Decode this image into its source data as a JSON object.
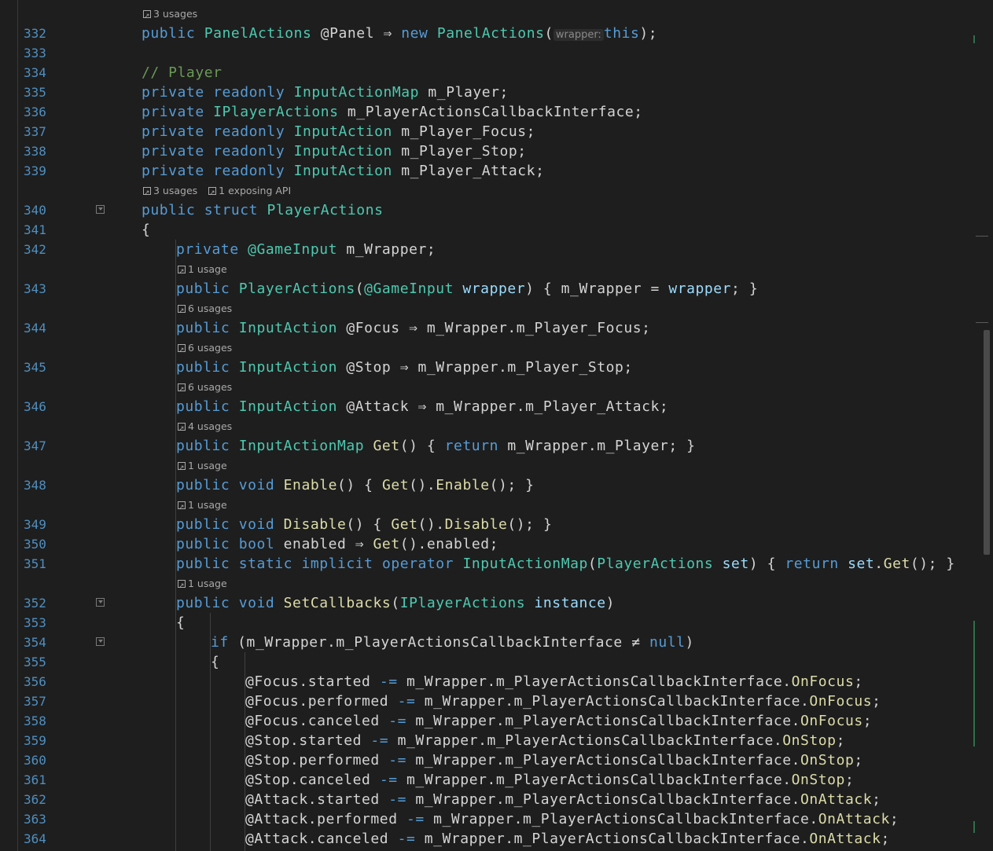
{
  "editor": {
    "language": "C#",
    "first_line_number": 332,
    "rows": [
      {
        "kind": "hint",
        "indent": 2,
        "parts": [
          {
            "icon": "usages-icon",
            "text": "3 usages"
          }
        ]
      },
      {
        "kind": "code",
        "ln": "332",
        "indent": 2,
        "tokens": [
          [
            "kw",
            "public"
          ],
          [
            "t",
            " "
          ],
          [
            "type",
            "PanelActions"
          ],
          [
            "t",
            " @Panel "
          ],
          [
            "op",
            "⇒"
          ],
          [
            "t",
            " "
          ],
          [
            "kw",
            "new"
          ],
          [
            "t",
            " "
          ],
          [
            "type",
            "PanelActions"
          ],
          [
            "t",
            "("
          ],
          [
            "inlay",
            "wrapper:"
          ],
          [
            "kw",
            "this"
          ],
          [
            "t",
            ");"
          ]
        ]
      },
      {
        "kind": "code",
        "ln": "333",
        "indent": 2,
        "tokens": []
      },
      {
        "kind": "code",
        "ln": "334",
        "indent": 2,
        "tokens": [
          [
            "comment",
            "// Player"
          ]
        ]
      },
      {
        "kind": "code",
        "ln": "335",
        "indent": 2,
        "tokens": [
          [
            "kw",
            "private"
          ],
          [
            "t",
            " "
          ],
          [
            "kw",
            "readonly"
          ],
          [
            "t",
            " "
          ],
          [
            "type",
            "InputActionMap"
          ],
          [
            "t",
            " m_Player;"
          ]
        ]
      },
      {
        "kind": "code",
        "ln": "336",
        "indent": 2,
        "tokens": [
          [
            "kw",
            "private"
          ],
          [
            "t",
            " "
          ],
          [
            "type",
            "IPlayerActions"
          ],
          [
            "t",
            " m_PlayerActionsCallbackInterface;"
          ]
        ]
      },
      {
        "kind": "code",
        "ln": "337",
        "indent": 2,
        "tokens": [
          [
            "kw",
            "private"
          ],
          [
            "t",
            " "
          ],
          [
            "kw",
            "readonly"
          ],
          [
            "t",
            " "
          ],
          [
            "type",
            "InputAction"
          ],
          [
            "t",
            " m_Player_Focus;"
          ]
        ]
      },
      {
        "kind": "code",
        "ln": "338",
        "indent": 2,
        "tokens": [
          [
            "kw",
            "private"
          ],
          [
            "t",
            " "
          ],
          [
            "kw",
            "readonly"
          ],
          [
            "t",
            " "
          ],
          [
            "type",
            "InputAction"
          ],
          [
            "t",
            " m_Player_Stop;"
          ]
        ]
      },
      {
        "kind": "code",
        "ln": "339",
        "indent": 2,
        "tokens": [
          [
            "kw",
            "private"
          ],
          [
            "t",
            " "
          ],
          [
            "kw",
            "readonly"
          ],
          [
            "t",
            " "
          ],
          [
            "type",
            "InputAction"
          ],
          [
            "t",
            " m_Player_Attack;"
          ]
        ]
      },
      {
        "kind": "hint",
        "indent": 2,
        "parts": [
          {
            "icon": "usages-icon",
            "text": "3 usages"
          },
          {
            "icon": "api-icon",
            "text": "1 exposing API"
          }
        ]
      },
      {
        "kind": "code",
        "ln": "340",
        "indent": 2,
        "fold": true,
        "tokens": [
          [
            "kw",
            "public"
          ],
          [
            "t",
            " "
          ],
          [
            "kw",
            "struct"
          ],
          [
            "t",
            " "
          ],
          [
            "type",
            "PlayerActions"
          ]
        ]
      },
      {
        "kind": "code",
        "ln": "341",
        "indent": 2,
        "tokens": [
          [
            "t",
            "{"
          ]
        ]
      },
      {
        "kind": "code",
        "ln": "342",
        "indent": 3,
        "tokens": [
          [
            "kw",
            "private"
          ],
          [
            "t",
            " "
          ],
          [
            "type",
            "@GameInput"
          ],
          [
            "t",
            " m_Wrapper;"
          ]
        ]
      },
      {
        "kind": "hint",
        "indent": 3,
        "parts": [
          {
            "icon": "usages-icon",
            "text": "1 usage"
          }
        ]
      },
      {
        "kind": "code",
        "ln": "343",
        "indent": 3,
        "tokens": [
          [
            "kw",
            "public"
          ],
          [
            "t",
            " "
          ],
          [
            "type",
            "PlayerActions"
          ],
          [
            "t",
            "("
          ],
          [
            "type",
            "@GameInput"
          ],
          [
            "t",
            " "
          ],
          [
            "param",
            "wrapper"
          ],
          [
            "t",
            ") { m_Wrapper = "
          ],
          [
            "param",
            "wrapper"
          ],
          [
            "t",
            "; }"
          ]
        ]
      },
      {
        "kind": "hint",
        "indent": 3,
        "parts": [
          {
            "icon": "usages-icon",
            "text": "6 usages"
          }
        ]
      },
      {
        "kind": "code",
        "ln": "344",
        "indent": 3,
        "tokens": [
          [
            "kw",
            "public"
          ],
          [
            "t",
            " "
          ],
          [
            "type",
            "InputAction"
          ],
          [
            "t",
            " @Focus "
          ],
          [
            "op",
            "⇒"
          ],
          [
            "t",
            " m_Wrapper.m_Player_Focus;"
          ]
        ]
      },
      {
        "kind": "hint",
        "indent": 3,
        "parts": [
          {
            "icon": "usages-icon",
            "text": "6 usages"
          }
        ]
      },
      {
        "kind": "code",
        "ln": "345",
        "indent": 3,
        "tokens": [
          [
            "kw",
            "public"
          ],
          [
            "t",
            " "
          ],
          [
            "type",
            "InputAction"
          ],
          [
            "t",
            " @Stop "
          ],
          [
            "op",
            "⇒"
          ],
          [
            "t",
            " m_Wrapper.m_Player_Stop;"
          ]
        ]
      },
      {
        "kind": "hint",
        "indent": 3,
        "parts": [
          {
            "icon": "usages-icon",
            "text": "6 usages"
          }
        ]
      },
      {
        "kind": "code",
        "ln": "346",
        "indent": 3,
        "tokens": [
          [
            "kw",
            "public"
          ],
          [
            "t",
            " "
          ],
          [
            "type",
            "InputAction"
          ],
          [
            "t",
            " @Attack "
          ],
          [
            "op",
            "⇒"
          ],
          [
            "t",
            " m_Wrapper.m_Player_Attack;"
          ]
        ]
      },
      {
        "kind": "hint",
        "indent": 3,
        "parts": [
          {
            "icon": "usages-icon",
            "text": "4 usages"
          }
        ]
      },
      {
        "kind": "code",
        "ln": "347",
        "indent": 3,
        "tokens": [
          [
            "kw",
            "public"
          ],
          [
            "t",
            " "
          ],
          [
            "type",
            "InputActionMap"
          ],
          [
            "t",
            " "
          ],
          [
            "method",
            "Get"
          ],
          [
            "t",
            "() { "
          ],
          [
            "kw",
            "return"
          ],
          [
            "t",
            " m_Wrapper.m_Player; }"
          ]
        ]
      },
      {
        "kind": "hint",
        "indent": 3,
        "parts": [
          {
            "icon": "usages-icon",
            "text": "1 usage"
          }
        ]
      },
      {
        "kind": "code",
        "ln": "348",
        "indent": 3,
        "tokens": [
          [
            "kw",
            "public"
          ],
          [
            "t",
            " "
          ],
          [
            "kw",
            "void"
          ],
          [
            "t",
            " "
          ],
          [
            "method",
            "Enable"
          ],
          [
            "t",
            "() { "
          ],
          [
            "method",
            "Get"
          ],
          [
            "t",
            "()."
          ],
          [
            "method",
            "Enable"
          ],
          [
            "t",
            "(); }"
          ]
        ]
      },
      {
        "kind": "hint",
        "indent": 3,
        "parts": [
          {
            "icon": "usages-icon",
            "text": "1 usage"
          }
        ]
      },
      {
        "kind": "code",
        "ln": "349",
        "indent": 3,
        "tokens": [
          [
            "kw",
            "public"
          ],
          [
            "t",
            " "
          ],
          [
            "kw",
            "void"
          ],
          [
            "t",
            " "
          ],
          [
            "method",
            "Disable"
          ],
          [
            "t",
            "() { "
          ],
          [
            "method",
            "Get"
          ],
          [
            "t",
            "()."
          ],
          [
            "method",
            "Disable"
          ],
          [
            "t",
            "(); }"
          ]
        ]
      },
      {
        "kind": "code",
        "ln": "350",
        "indent": 3,
        "tokens": [
          [
            "kw",
            "public"
          ],
          [
            "t",
            " "
          ],
          [
            "kw",
            "bool"
          ],
          [
            "t",
            " enabled "
          ],
          [
            "op",
            "⇒"
          ],
          [
            "t",
            " "
          ],
          [
            "method",
            "Get"
          ],
          [
            "t",
            "().enabled;"
          ]
        ]
      },
      {
        "kind": "code",
        "ln": "351",
        "indent": 3,
        "tokens": [
          [
            "kw",
            "public"
          ],
          [
            "t",
            " "
          ],
          [
            "kw",
            "static"
          ],
          [
            "t",
            " "
          ],
          [
            "kw",
            "implicit"
          ],
          [
            "t",
            " "
          ],
          [
            "kw",
            "operator"
          ],
          [
            "t",
            " "
          ],
          [
            "type",
            "InputActionMap"
          ],
          [
            "t",
            "("
          ],
          [
            "type",
            "PlayerActions"
          ],
          [
            "t",
            " "
          ],
          [
            "param",
            "set"
          ],
          [
            "t",
            ") { "
          ],
          [
            "kw",
            "return"
          ],
          [
            "t",
            " "
          ],
          [
            "param",
            "set"
          ],
          [
            "t",
            "."
          ],
          [
            "method",
            "Get"
          ],
          [
            "t",
            "(); }"
          ]
        ]
      },
      {
        "kind": "hint",
        "indent": 3,
        "parts": [
          {
            "icon": "usages-icon",
            "text": "1 usage"
          }
        ]
      },
      {
        "kind": "code",
        "ln": "352",
        "indent": 3,
        "fold": true,
        "tokens": [
          [
            "kw",
            "public"
          ],
          [
            "t",
            " "
          ],
          [
            "kw",
            "void"
          ],
          [
            "t",
            " "
          ],
          [
            "method",
            "SetCallbacks"
          ],
          [
            "t",
            "("
          ],
          [
            "type",
            "IPlayerActions"
          ],
          [
            "t",
            " "
          ],
          [
            "param",
            "instance"
          ],
          [
            "t",
            ")"
          ]
        ]
      },
      {
        "kind": "code",
        "ln": "353",
        "indent": 3,
        "tokens": [
          [
            "t",
            "{"
          ]
        ]
      },
      {
        "kind": "code",
        "ln": "354",
        "indent": 4,
        "fold": true,
        "tokens": [
          [
            "kw",
            "if"
          ],
          [
            "t",
            " (m_Wrapper.m_PlayerActionsCallbackInterface "
          ],
          [
            "op",
            "≠"
          ],
          [
            "t",
            " "
          ],
          [
            "kw",
            "null"
          ],
          [
            "t",
            ")"
          ]
        ]
      },
      {
        "kind": "code",
        "ln": "355",
        "indent": 4,
        "tokens": [
          [
            "t",
            "{"
          ]
        ]
      },
      {
        "kind": "code",
        "ln": "356",
        "indent": 5,
        "tokens": [
          [
            "t",
            "@Focus.started "
          ],
          [
            "kw",
            "-="
          ],
          [
            "t",
            " m_Wrapper.m_PlayerActionsCallbackInterface."
          ],
          [
            "method",
            "OnFocus"
          ],
          [
            "t",
            ";"
          ]
        ]
      },
      {
        "kind": "code",
        "ln": "357",
        "indent": 5,
        "tokens": [
          [
            "t",
            "@Focus.performed "
          ],
          [
            "kw",
            "-="
          ],
          [
            "t",
            " m_Wrapper.m_PlayerActionsCallbackInterface."
          ],
          [
            "method",
            "OnFocus"
          ],
          [
            "t",
            ";"
          ]
        ]
      },
      {
        "kind": "code",
        "ln": "358",
        "indent": 5,
        "tokens": [
          [
            "t",
            "@Focus.canceled "
          ],
          [
            "kw",
            "-="
          ],
          [
            "t",
            " m_Wrapper.m_PlayerActionsCallbackInterface."
          ],
          [
            "method",
            "OnFocus"
          ],
          [
            "t",
            ";"
          ]
        ]
      },
      {
        "kind": "code",
        "ln": "359",
        "indent": 5,
        "tokens": [
          [
            "t",
            "@Stop.started "
          ],
          [
            "kw",
            "-="
          ],
          [
            "t",
            " m_Wrapper.m_PlayerActionsCallbackInterface."
          ],
          [
            "method",
            "OnStop"
          ],
          [
            "t",
            ";"
          ]
        ]
      },
      {
        "kind": "code",
        "ln": "360",
        "indent": 5,
        "tokens": [
          [
            "t",
            "@Stop.performed "
          ],
          [
            "kw",
            "-="
          ],
          [
            "t",
            " m_Wrapper.m_PlayerActionsCallbackInterface."
          ],
          [
            "method",
            "OnStop"
          ],
          [
            "t",
            ";"
          ]
        ]
      },
      {
        "kind": "code",
        "ln": "361",
        "indent": 5,
        "tokens": [
          [
            "t",
            "@Stop.canceled "
          ],
          [
            "kw",
            "-="
          ],
          [
            "t",
            " m_Wrapper.m_PlayerActionsCallbackInterface."
          ],
          [
            "method",
            "OnStop"
          ],
          [
            "t",
            ";"
          ]
        ]
      },
      {
        "kind": "code",
        "ln": "362",
        "indent": 5,
        "tokens": [
          [
            "t",
            "@Attack.started "
          ],
          [
            "kw",
            "-="
          ],
          [
            "t",
            " m_Wrapper.m_PlayerActionsCallbackInterface."
          ],
          [
            "method",
            "OnAttack"
          ],
          [
            "t",
            ";"
          ]
        ]
      },
      {
        "kind": "code",
        "ln": "363",
        "indent": 5,
        "tokens": [
          [
            "t",
            "@Attack.performed "
          ],
          [
            "kw",
            "-="
          ],
          [
            "t",
            " m_Wrapper.m_PlayerActionsCallbackInterface."
          ],
          [
            "method",
            "OnAttack"
          ],
          [
            "t",
            ";"
          ]
        ]
      },
      {
        "kind": "code",
        "ln": "364",
        "indent": 5,
        "tokens": [
          [
            "t",
            "@Attack.canceled "
          ],
          [
            "kw",
            "-="
          ],
          [
            "t",
            " m_Wrapper.m_PlayerActionsCallbackInterface."
          ],
          [
            "method",
            "OnAttack"
          ],
          [
            "t",
            ";"
          ]
        ]
      }
    ]
  },
  "colors": {
    "background": "#1e1e1e",
    "line_number": "#4f8fc0",
    "keyword": "#569cd6",
    "type": "#4ec9b0",
    "method": "#dcdcaa",
    "comment": "#6a9955",
    "parameter": "#9cdcfe",
    "text": "#d4d4d4",
    "hint": "#a9a9a9"
  }
}
